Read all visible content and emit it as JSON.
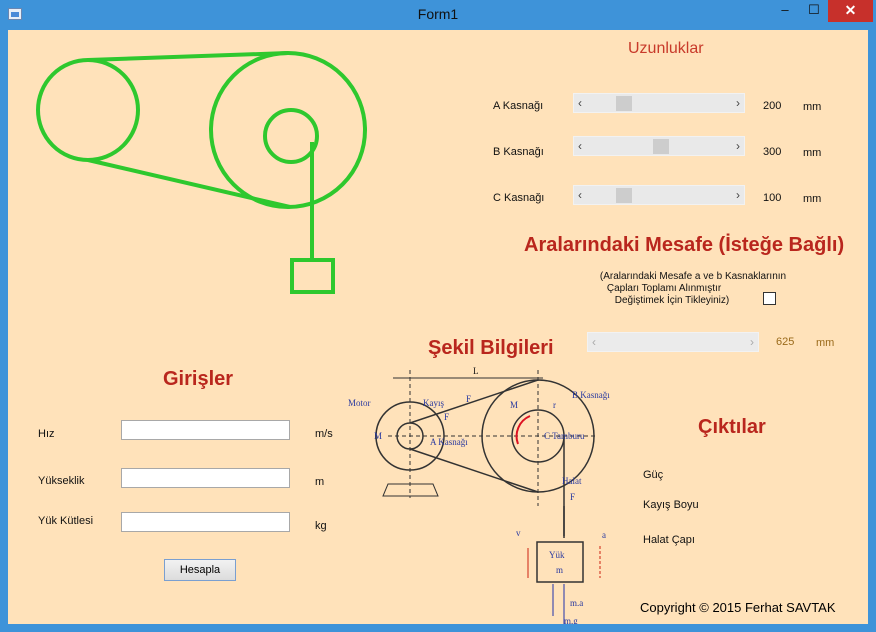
{
  "window": {
    "title": "Form1",
    "minimize": "‒",
    "maximize": "☐",
    "close": "✕"
  },
  "uzunluklar": {
    "title": "Uzunluklar",
    "rows": [
      {
        "label": "A Kasnağı",
        "value": "200",
        "unit": "mm",
        "position": 0.17
      },
      {
        "label": "B Kasnağı",
        "value": "300",
        "unit": "mm",
        "position": 0.55
      },
      {
        "label": "C Kasnağı",
        "value": "100",
        "unit": "mm",
        "position": 0.17
      }
    ]
  },
  "mesafe": {
    "title": "Aralarındaki Mesafe (İsteğe Bağlı)",
    "note_line1": "(Aralarındaki Mesafe a ve b Kasnaklarının",
    "note_line2": "Çapları Toplamı Alınmıştır",
    "note_line3": "Değiştimek İçin Tikleyiniz)",
    "value": "625",
    "unit": "mm"
  },
  "sekil": {
    "title": "Şekil Bilgileri",
    "labels": {
      "L": "L",
      "motor": "Motor",
      "kayis": "Kayış",
      "fb": "F",
      "fa": "F",
      "mc_mb": "M",
      "rb": "r",
      "b_kasnagi": "B Kasnağı",
      "ma": "M",
      "a_kasnagi": "A Kasnağı",
      "c_tamburu": "C Tamburu",
      "halat": "Halat",
      "fc": "F",
      "v": "v",
      "a": "a",
      "yuk": "Yük",
      "m": "m",
      "ma_force": "m.a",
      "mg": "m.g"
    }
  },
  "girisler": {
    "title": "Girişler",
    "fields": [
      {
        "label": "Hız",
        "value": "",
        "unit": "m/s"
      },
      {
        "label": "Yükseklik",
        "value": "",
        "unit": "m"
      },
      {
        "label": "Yük Kütlesi",
        "value": "",
        "unit": "kg"
      }
    ],
    "button": "Hesapla"
  },
  "ciktilar": {
    "title": "Çıktılar",
    "items": [
      "Güç",
      "Kayış Boyu",
      "Halat Çapı"
    ]
  },
  "copyright": "Copyright © 2015 Ferhat SAVTAK",
  "colors": {
    "accent": "#b9261d",
    "drawing": "#2ec82e",
    "client_bg": "#ffe2ba",
    "titlebar": "#3e93d9"
  }
}
